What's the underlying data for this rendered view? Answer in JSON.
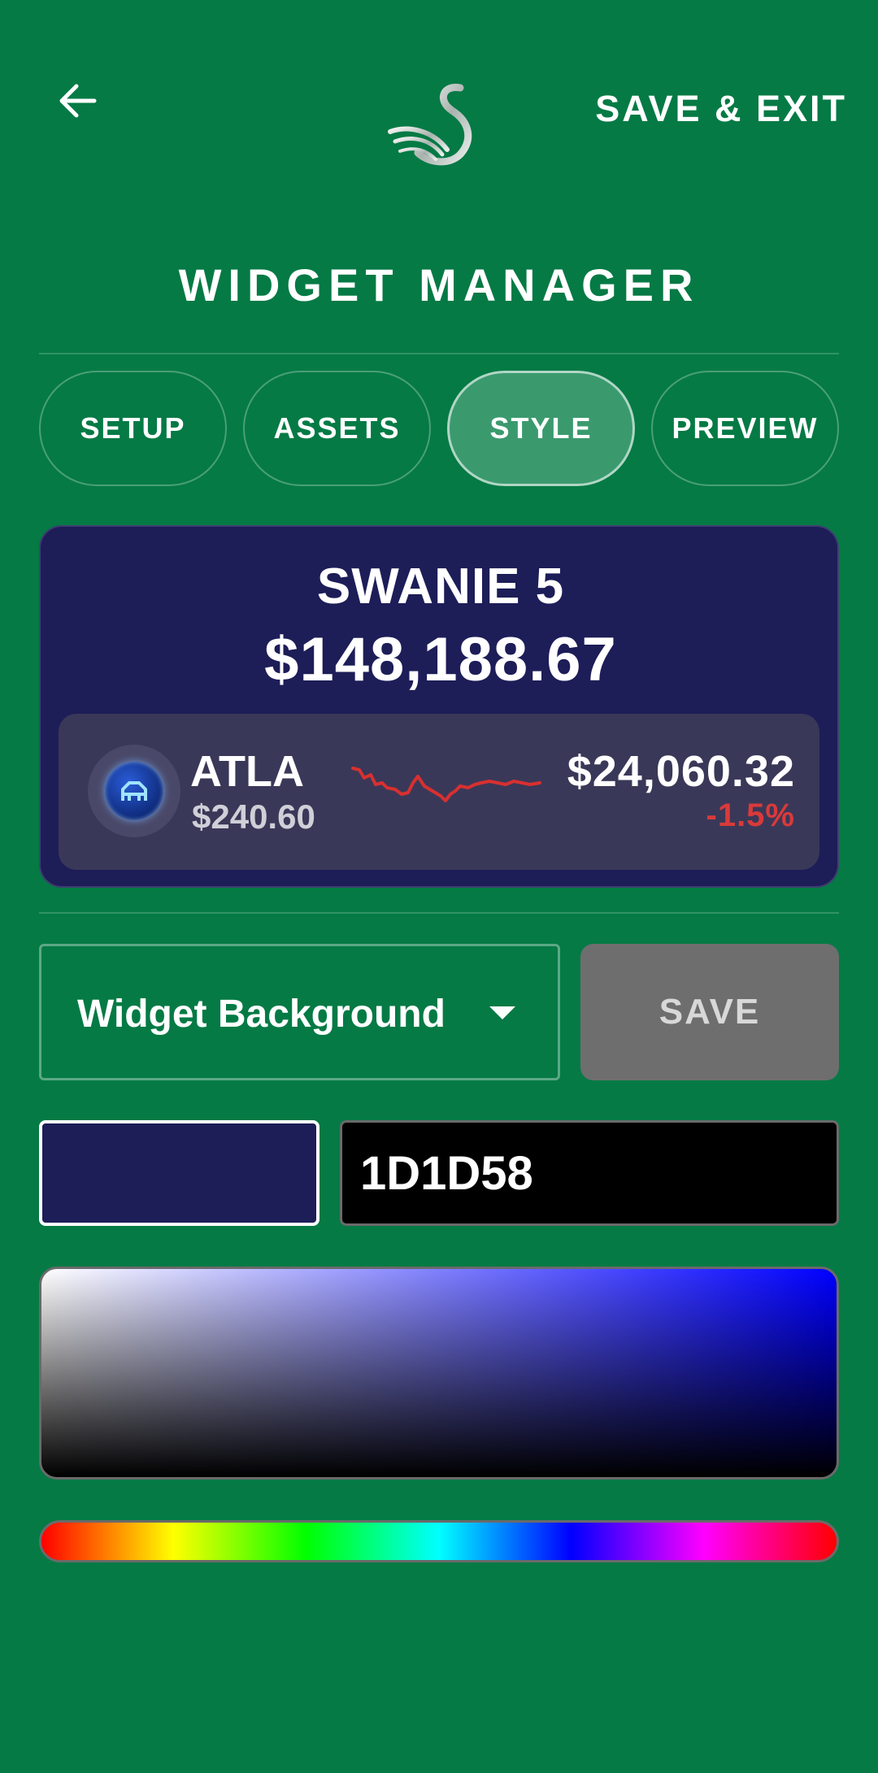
{
  "header": {
    "back_icon": "arrow-left-icon",
    "logo_icon": "swan-logo-icon",
    "save_exit_label": "SAVE & EXIT",
    "title": "WIDGET MANAGER"
  },
  "tabs": [
    {
      "label": "SETUP",
      "active": false
    },
    {
      "label": "ASSETS",
      "active": false
    },
    {
      "label": "STYLE",
      "active": true
    },
    {
      "label": "PREVIEW",
      "active": false
    }
  ],
  "widget": {
    "name": "SWANIE 5",
    "total": "$148,188.67",
    "background_color": "#1D1D58",
    "asset": {
      "icon": "atla-coin-icon",
      "symbol": "ATLA",
      "price": "$240.60",
      "value": "$24,060.32",
      "change": "-1.5%",
      "change_color": "#D93A3A"
    }
  },
  "controls": {
    "dropdown_label": "Widget Background",
    "save_label": "SAVE",
    "hex_value": "1D1D58",
    "selected_color": "#1D1D58"
  },
  "colors": {
    "page_background": "#057A45",
    "active_tab": "#3A9A6E",
    "save_disabled": "#6E6E6E"
  }
}
